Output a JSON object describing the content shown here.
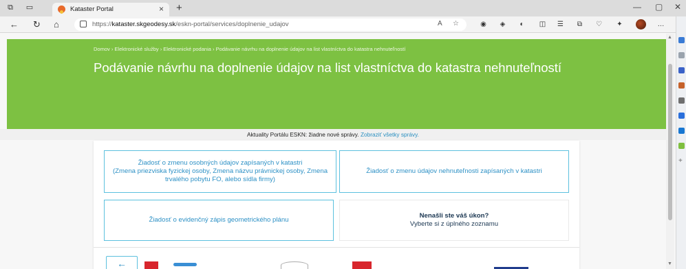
{
  "browser": {
    "tab_title": "Kataster Portal",
    "tab_close": "×",
    "new_tab": "+",
    "url_prefix": "https://",
    "url_host": "kataster.skgeodesy.sk",
    "url_path": "/eskn-portal/services/doplnenie_udajov"
  },
  "page": {
    "breadcrumb": "Domov › Elektronické služby › Elektronické podania › Podávanie návrhu na doplnenie údajov na list vlastníctva do katastra nehnuteľností",
    "heading": "Podávanie návrhu na doplnenie údajov na list vlastníctva do katastra nehnuteľností",
    "news_text": "Aktuality Portálu ESKN: žiadne nové správy.",
    "news_link": "Zobraziť všetky správy."
  },
  "cards": [
    {
      "title": "Žiadosť o zmenu osobných údajov zapísaných v katastri",
      "subtitle": "(Zmena priezviska fyzickej osoby, Zmena názvu právnickej osoby, Zmena trvalého pobytu FO, alebo sídla firmy)"
    },
    {
      "title": "Žiadosť o zmenu údajov nehnuteľnosti zapísaných v katastri",
      "subtitle": ""
    },
    {
      "title": "Žiadosť o evidenčný zápis geometrického plánu",
      "subtitle": ""
    },
    {
      "title": "Nenašli ste váš úkon?",
      "subtitle": "Vyberte si z úplného zoznamu"
    }
  ],
  "back_button": "←",
  "colors": {
    "hero": "#7dc142",
    "accent": "#2c90c5",
    "card_border": "#5bc0de"
  }
}
